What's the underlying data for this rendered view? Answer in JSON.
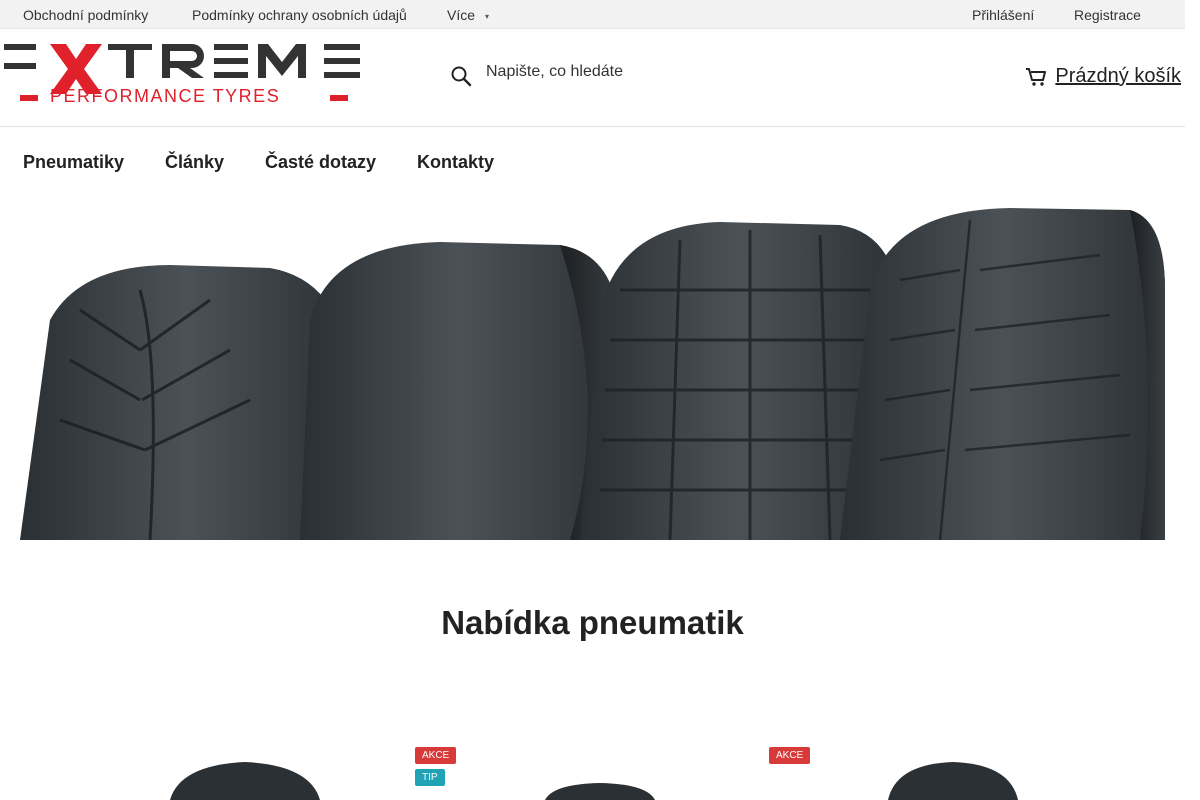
{
  "topbar": {
    "links": [
      "Obchodní podmínky",
      "Podmínky ochrany osobních údajů"
    ],
    "more_label": "Více",
    "login_label": "Přihlášení",
    "register_label": "Registrace"
  },
  "logo": {
    "main_text": "XTREME",
    "sub_text": "PERFORMANCE TYRES",
    "brand_color": "#e0202a"
  },
  "search": {
    "placeholder": "Napište, co hledáte",
    "icon": "search-icon"
  },
  "cart": {
    "label": "Prázdný košík",
    "icon": "cart-icon"
  },
  "nav": {
    "items": [
      "Pneumatiky",
      "Články",
      "Časté dotazy",
      "Kontakty"
    ]
  },
  "hero": {
    "description": "banner-image"
  },
  "offers": {
    "title": "Nabídka pneumatik",
    "badges": {
      "akce": "AKCE",
      "tip": "TIP"
    },
    "colors": {
      "akce": "#d83a3a",
      "tip": "#1fa3b5"
    }
  }
}
